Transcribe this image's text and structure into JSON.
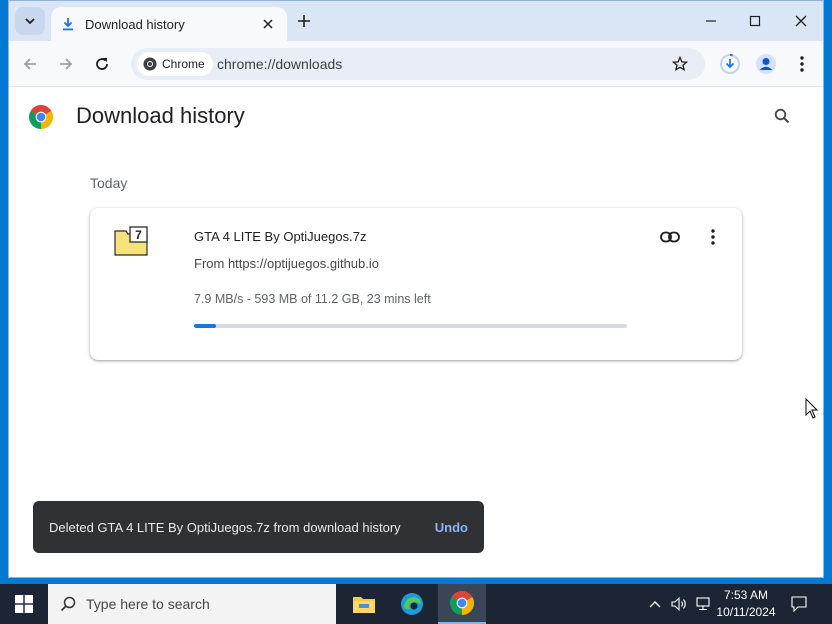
{
  "tab": {
    "title": "Download history"
  },
  "toolbar": {
    "chip_label": "Chrome",
    "url": "chrome://downloads"
  },
  "page": {
    "title": "Download history",
    "date_header": "Today"
  },
  "download": {
    "file_name": "GTA 4 LITE By OptiJuegos.7z",
    "source": "From https://optijuegos.github.io",
    "status": "7.9 MB/s - 593 MB of 11.2 GB, 23 mins left",
    "progress_percent": 5,
    "file_icon_label": "7"
  },
  "toast": {
    "message": "Deleted GTA 4 LITE By OptiJuegos.7z from download history",
    "action": "Undo"
  },
  "taskbar": {
    "search_placeholder": "Type here to search",
    "time": "7:53 AM",
    "date": "10/11/2024"
  },
  "colors": {
    "accent": "#1a73e8",
    "tabbar": "#dae5f5",
    "taskbar": "#1c2533",
    "desktop": "#0078d4"
  }
}
